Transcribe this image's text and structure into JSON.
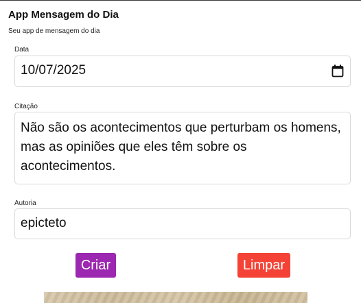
{
  "header": {
    "title": "App Mensagem do Dia",
    "subtitle": "Seu app de mensagem do dia"
  },
  "form": {
    "date": {
      "label": "Data",
      "value": "10/07/2025",
      "icon": "calendar-icon"
    },
    "quote": {
      "label": "Citação",
      "value": "Não são os acontecimentos que perturbam os homens, mas as opiniões que eles têm sobre os acontecimentos."
    },
    "author": {
      "label": "Autoria",
      "value": "epicteto"
    }
  },
  "buttons": {
    "create_label": "Criar",
    "clear_label": "Limpar"
  },
  "colors": {
    "create": "#9c27b0",
    "clear": "#f44336",
    "field_border": "#d9d9d9"
  }
}
